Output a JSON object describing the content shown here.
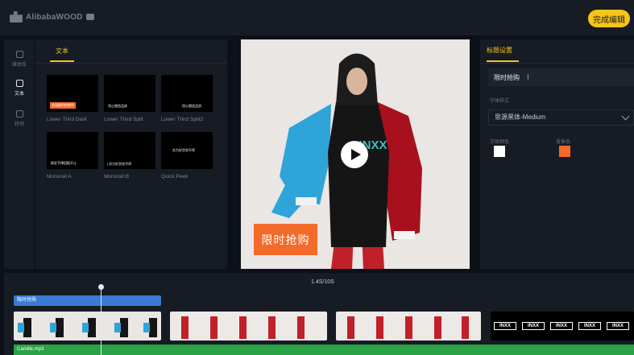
{
  "app": {
    "name": "AlibabaWOOD"
  },
  "header": {
    "finish_label": "完成编辑"
  },
  "left_rail": {
    "items": [
      {
        "label": "媒体库"
      },
      {
        "label": "文本"
      },
      {
        "label": "转场"
      }
    ],
    "active": "文本"
  },
  "asset_panel": {
    "tab_label": "文本",
    "templates": [
      {
        "label": "Lower Third Dark",
        "thumb_text": "全场限时抢购中"
      },
      {
        "label": "Lower Third Split",
        "thumb_text": "用心塑造品质"
      },
      {
        "label": "Lower Third Split2",
        "thumb_text": "用心塑造品质"
      },
      {
        "label": "Monorail A",
        "thumb_text": "疯狂手律回报不止"
      },
      {
        "label": "Monorail B",
        "thumb_text": "| 实力好货宅不停"
      },
      {
        "label": "Quick Peek",
        "thumb_text": "实力好货宅不停"
      }
    ]
  },
  "preview": {
    "caption": "限时抢购",
    "shirt_text": "INXX"
  },
  "settings": {
    "tab_label": "标题设置",
    "title_value": "限时抢购",
    "font_style_label": "字体样式",
    "font_value": "思源黑体-Medium",
    "font_color_label": "字体颜色",
    "bg_color_label": "背景色",
    "font_color": "#ffffff",
    "bg_color": "#f36b2a"
  },
  "timeline": {
    "time_readout": "1.4S/10S",
    "text_clip_label": "限时抢购",
    "audio_label": "Camille.mp3",
    "logo_clip_text": "INXX"
  }
}
